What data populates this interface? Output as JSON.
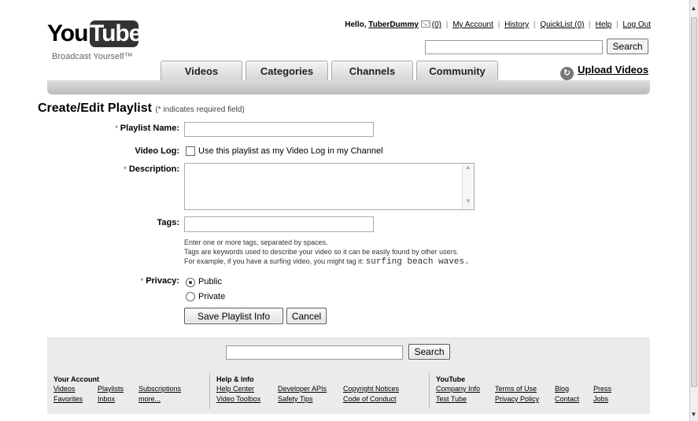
{
  "header": {
    "logo_you": "You",
    "logo_tube": "Tube",
    "slogan": "Broadcast Yourself™",
    "greeting": "Hello,",
    "username": "TuberDummy",
    "inbox_count": "(0)",
    "my_account": "My Account",
    "history": "History",
    "quicklist": "QuickList (0)",
    "help": "Help",
    "logout": "Log Out",
    "search_button": "Search",
    "search_value": "",
    "upload": "Upload Videos"
  },
  "tabs": [
    {
      "label": "Videos"
    },
    {
      "label": "Categories"
    },
    {
      "label": "Channels"
    },
    {
      "label": "Community"
    }
  ],
  "form": {
    "title": "Create/Edit Playlist",
    "required_note": "(* indicates required field)",
    "required_mark": "*",
    "name_label": "Playlist Name:",
    "name_value": "",
    "videolog_label": "Video Log:",
    "videolog_text": "Use this playlist as my Video Log in my Channel",
    "videolog_checked": false,
    "description_label": "Description:",
    "description_value": "",
    "tags_label": "Tags:",
    "tags_value": "",
    "tags_help_1": "Enter one or more tags, separated by spaces.",
    "tags_help_2": "Tags are keywords used to describe your video so it can be easily found by other users.",
    "tags_help_3": "For example, if you have a surfing video, you might tag it:",
    "tags_example": "surfing beach waves.",
    "privacy_label": "Privacy:",
    "privacy_options": [
      "Public",
      "Private"
    ],
    "privacy_selected": "Public",
    "save_button": "Save Playlist Info",
    "cancel_button": "Cancel"
  },
  "footer": {
    "search_button": "Search",
    "search_value": "",
    "columns": [
      {
        "heading": "Your Account",
        "links": [
          "Videos",
          "Playlists",
          "Subscriptions",
          "Favorites",
          "Inbox",
          "more..."
        ]
      },
      {
        "heading": "Help & Info",
        "links": [
          "Help Center",
          "Developer APIs",
          "Copyright Notices",
          "Video Toolbox",
          "Safety Tips",
          "Code of Conduct"
        ]
      },
      {
        "heading": "YouTube",
        "links": [
          "Company Info",
          "Terms of Use",
          "Blog",
          "Press",
          "Test Tube",
          "Privacy Policy",
          "Contact",
          "Jobs"
        ]
      }
    ]
  },
  "icons": {
    "mail": "mail-icon",
    "upload": "upload-arrow-icon"
  }
}
